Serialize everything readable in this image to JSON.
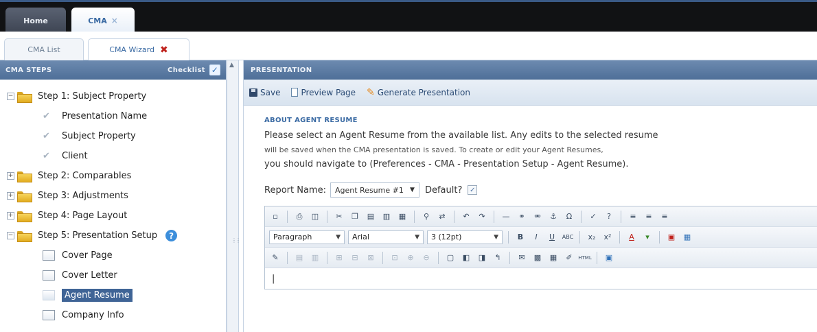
{
  "top_tabs": [
    {
      "label": "Home"
    },
    {
      "label": "CMA",
      "close": "×"
    }
  ],
  "sub_tabs": [
    {
      "label": "CMA List"
    },
    {
      "label": "CMA Wizard",
      "close": "✖"
    }
  ],
  "left_panel": {
    "title": "CMA STEPS",
    "checklist_label": "Checklist",
    "tree": [
      {
        "type": "folder",
        "expander": "−",
        "label": "Step 1: Subject Property"
      },
      {
        "type": "check",
        "label": "Presentation Name"
      },
      {
        "type": "check",
        "label": "Subject Property"
      },
      {
        "type": "check",
        "label": "Client"
      },
      {
        "type": "folder",
        "expander": "+",
        "label": "Step 2: Comparables"
      },
      {
        "type": "folder",
        "expander": "+",
        "label": "Step 3: Adjustments"
      },
      {
        "type": "folder",
        "expander": "+",
        "label": "Step 4: Page Layout"
      },
      {
        "type": "folder",
        "expander": "−",
        "label": "Step 5: Presentation Setup",
        "help": "?"
      },
      {
        "type": "page",
        "label": "Cover Page"
      },
      {
        "type": "page",
        "label": "Cover Letter"
      },
      {
        "type": "page",
        "label": "Agent Resume",
        "selected": true
      },
      {
        "type": "page",
        "label": "Company Info"
      }
    ]
  },
  "right_panel": {
    "title": "PRESENTATION",
    "actions": {
      "save": "Save",
      "preview": "Preview Page",
      "generate": "Generate Presentation"
    },
    "about": {
      "title": "ABOUT AGENT RESUME",
      "line1": "Please select an Agent Resume from the available list. Any edits to the selected resume",
      "line2": "will be saved when the CMA presentation is saved. To create or edit your Agent Resumes,",
      "line3": "you should navigate to (Preferences - CMA - Presentation Setup - Agent Resume)."
    },
    "report": {
      "label": "Report Name:",
      "selected": "Agent Resume #1",
      "default_label": "Default?",
      "default_mark": "✓"
    },
    "editor": {
      "format": "Paragraph",
      "font": "Arial",
      "size": "3 (12pt)",
      "cursor": "|"
    }
  }
}
